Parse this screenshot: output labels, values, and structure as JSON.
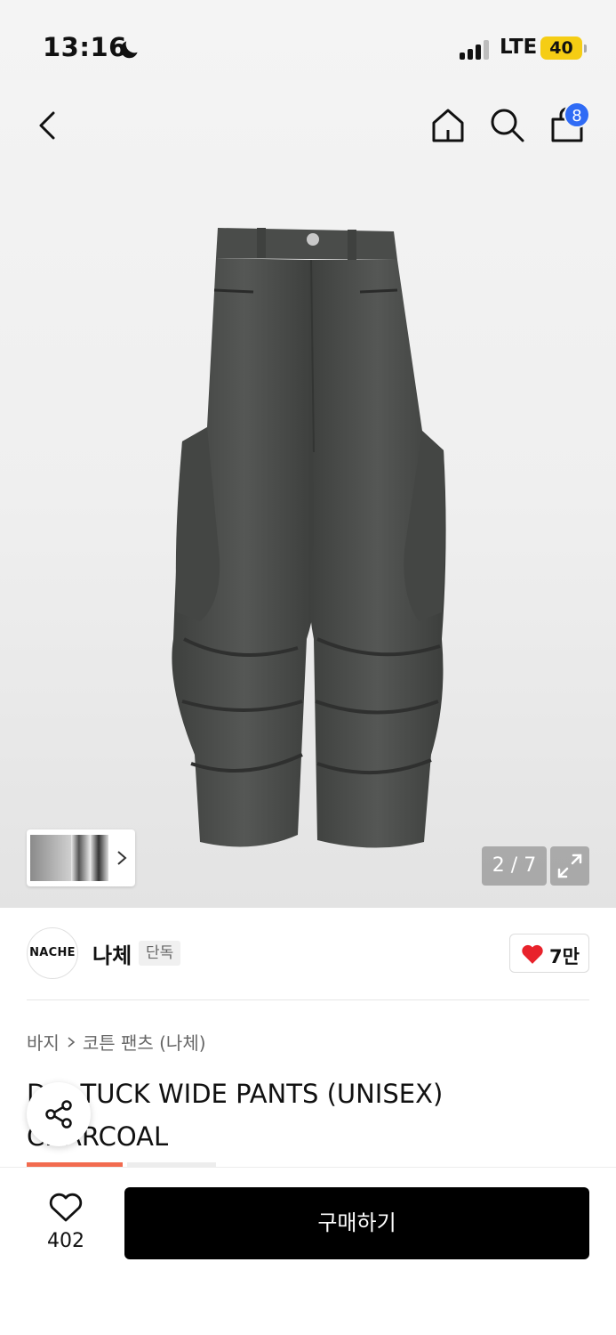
{
  "status_bar": {
    "time": "13:16",
    "network": "LTE",
    "battery": "40",
    "battery_color": "#f5cd14"
  },
  "nav": {
    "back_icon": "chevron-left-icon",
    "home_icon": "home-icon",
    "search_icon": "search-icon",
    "cart_icon": "shopping-bag-icon",
    "cart_count": "8",
    "badge_color": "#2f6bf5"
  },
  "gallery": {
    "counter": "2 / 7",
    "expand_icon": "expand-icon"
  },
  "brand": {
    "logo_text": "NACHE",
    "name": "나체",
    "tag": "단독",
    "likes": "7만",
    "heart_color": "#e8222b"
  },
  "product": {
    "breadcrumb": [
      "바지",
      "코튼 팬츠 (나체)"
    ],
    "title": "D… TUCK WIDE PANTS (UNISEX) CHARCOAL"
  },
  "bottom_bar": {
    "wish_count": "402",
    "buy_label": "구매하기"
  }
}
